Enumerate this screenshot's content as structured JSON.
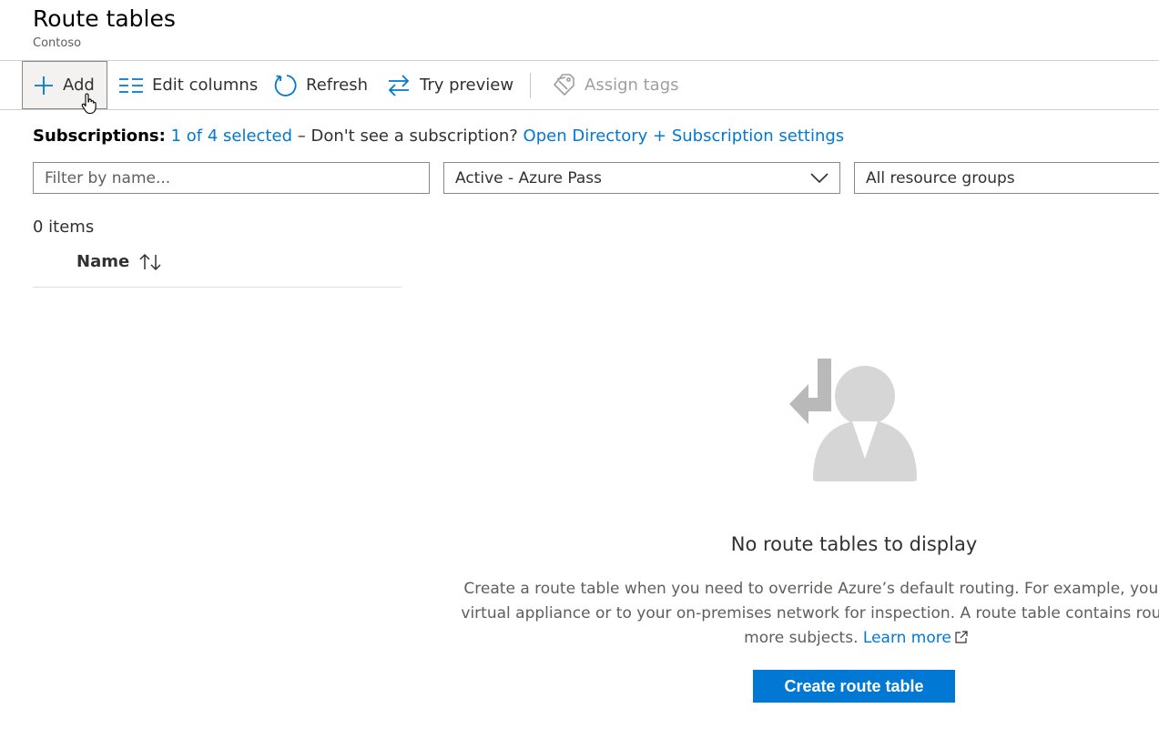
{
  "page": {
    "title": "Route tables",
    "subtitle": "Contoso"
  },
  "toolbar": {
    "add_label": "Add",
    "edit_columns_label": "Edit columns",
    "refresh_label": "Refresh",
    "try_preview_label": "Try preview",
    "assign_tags_label": "Assign tags"
  },
  "subscriptions": {
    "label": "Subscriptions:",
    "selected_link": "1 of 4 selected",
    "prompt": "– Don't see a subscription?",
    "settings_link": "Open Directory + Subscription settings"
  },
  "filters": {
    "name_placeholder": "Filter by name...",
    "subscription_value": "Active - Azure Pass",
    "resource_group_value": "All resource groups"
  },
  "list": {
    "count": "0 items",
    "column_name": "Name"
  },
  "empty_state": {
    "title": "No route tables to display",
    "description_line1": "Create a route table when you need to override Azure’s default routing. For example, you can route t",
    "description_line2": "virtual appliance or to your on-premises network for inspection. A route table contains routes and is a",
    "description_line3": "more subjects.",
    "learn_more": "Learn more",
    "create_button": "Create route table"
  },
  "colors": {
    "accent": "#0078d4",
    "text": "#323130",
    "muted": "#605e5c",
    "illustration": "#d6d6d6"
  },
  "icons": [
    "plus-icon",
    "edit-columns-icon",
    "refresh-icon",
    "swap-arrows-icon",
    "tag-icon",
    "chevron-down-icon",
    "sort-icon",
    "external-link-icon",
    "hand-cursor-icon",
    "no-results-illustration"
  ]
}
